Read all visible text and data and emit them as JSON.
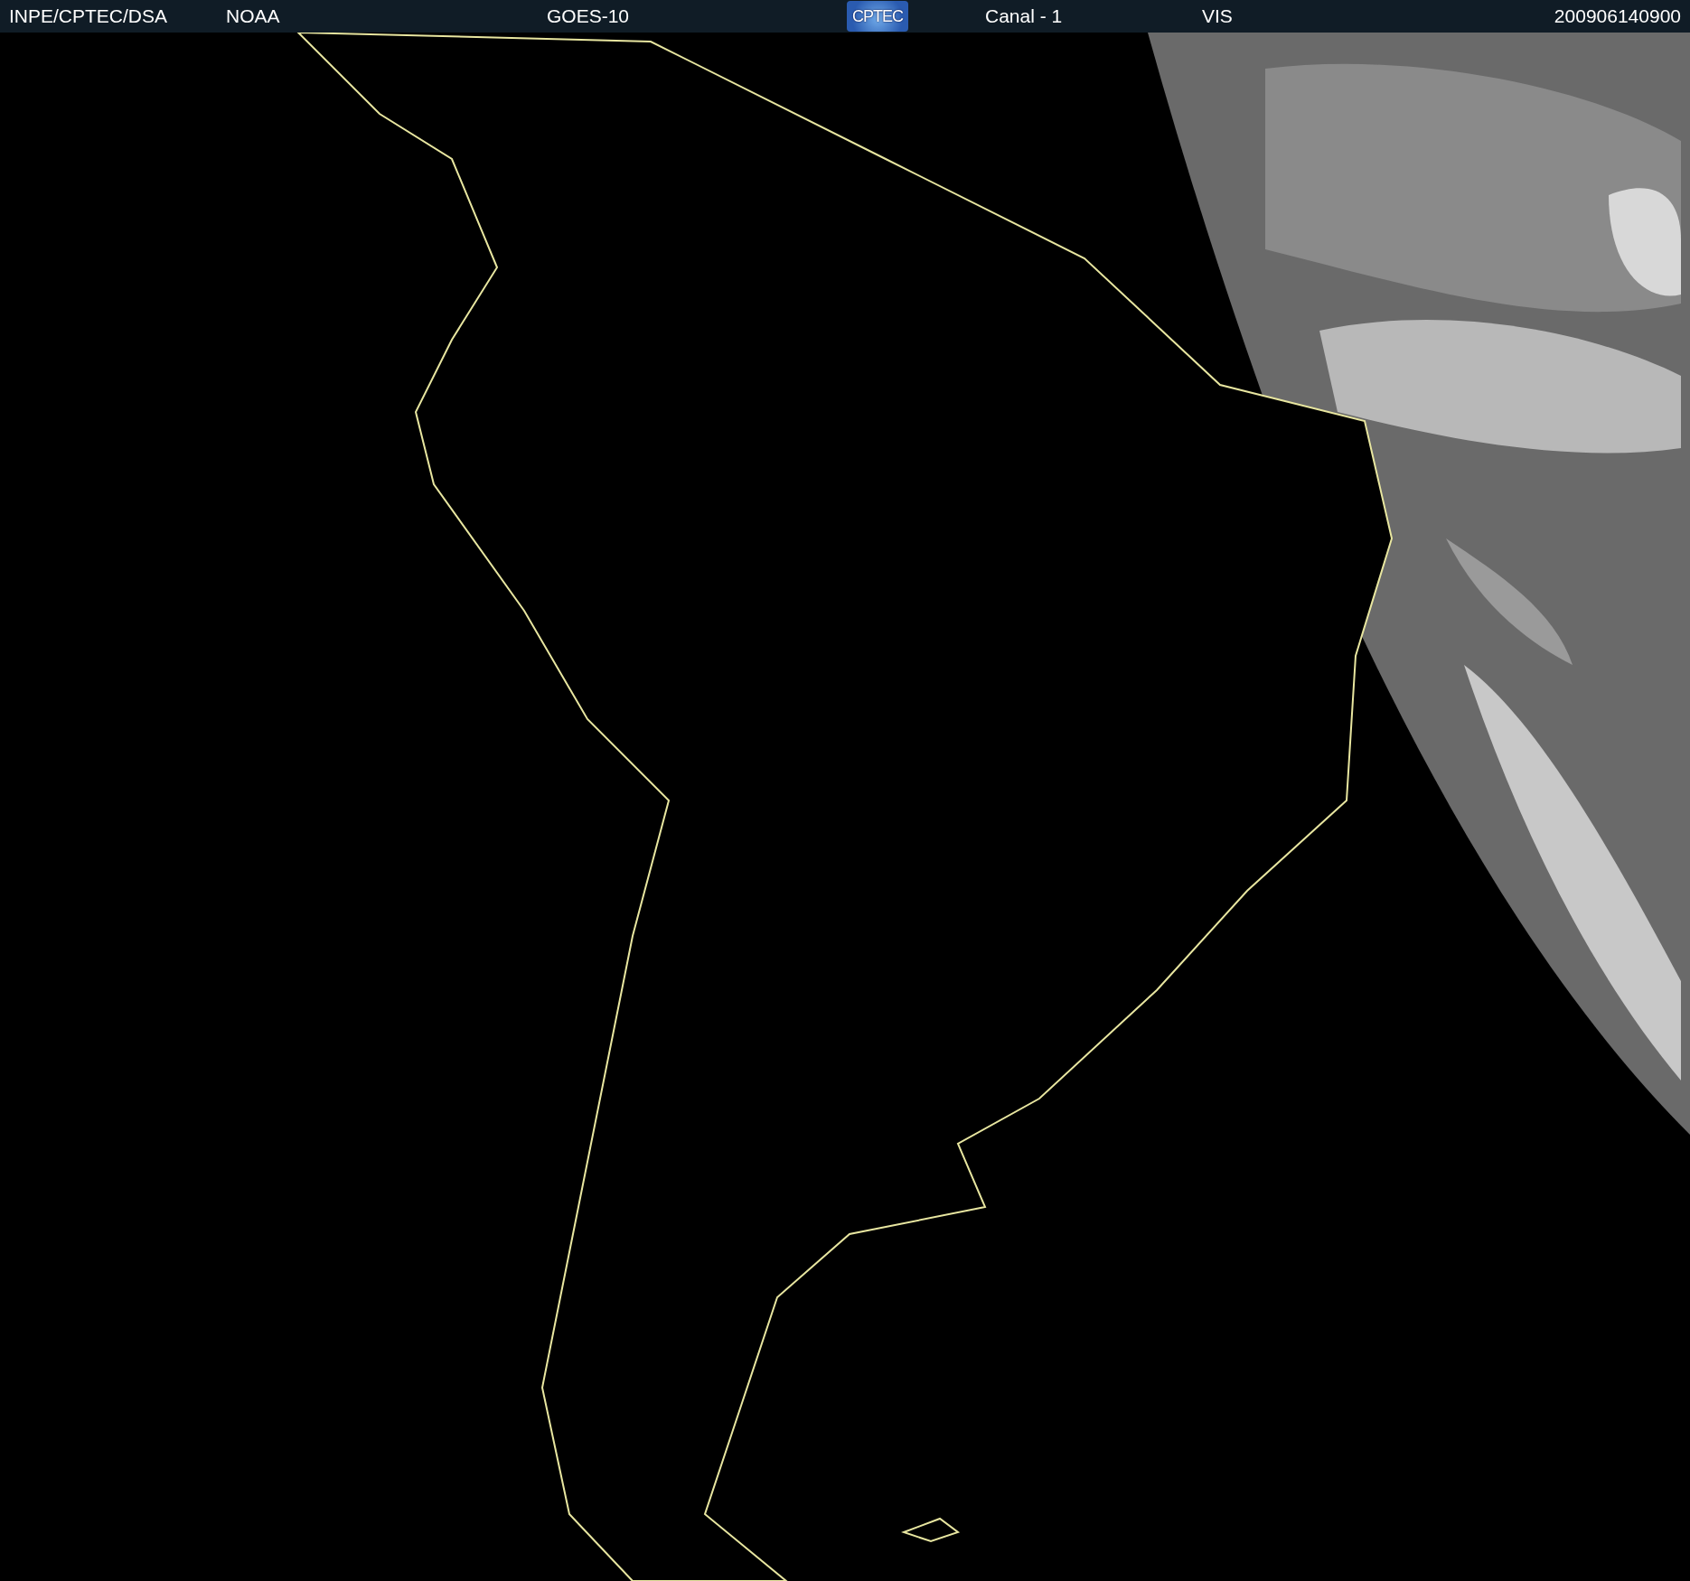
{
  "header": {
    "items": [
      {
        "kind": "text",
        "text": "INPE/CPTEC/DSA"
      },
      {
        "kind": "text",
        "text": "NOAA"
      },
      {
        "kind": "text",
        "text": "GOES-10"
      },
      {
        "kind": "logo",
        "text": "CPTEC"
      },
      {
        "kind": "text",
        "text": "Canal - 1"
      },
      {
        "kind": "text",
        "text": "VIS"
      },
      {
        "kind": "date",
        "text": "200906140900"
      }
    ]
  }
}
